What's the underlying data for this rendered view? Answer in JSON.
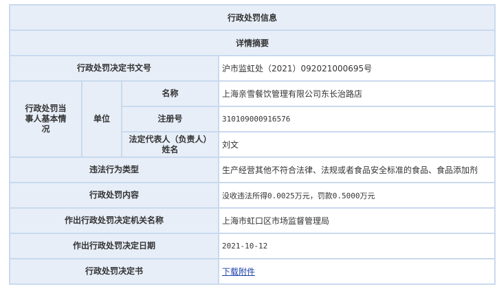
{
  "section_title": "行政处罚信息",
  "subsection_title": "详情摘要",
  "rows": {
    "decision_no": {
      "label": "行政处罚决定书文号",
      "value": "沪市监虹处（2021）092021000695号"
    },
    "party": {
      "label": "行政处罚当事人基本情况",
      "group_label": "单位",
      "name": {
        "label": "名称",
        "value": "上海亲雪餐饮管理有限公司东长治路店"
      },
      "reg_no": {
        "label": "注册号",
        "value": "310109000916576"
      },
      "legal_rep": {
        "label_line1": "法定代表人（负责人）",
        "label_line2": "姓名",
        "value": "刘文"
      }
    },
    "violation_type": {
      "label": "违法行为类型",
      "value": "生产经营其他不符合法律、法规或者食品安全标准的食品、食品添加剂"
    },
    "penalty_content": {
      "label": "行政处罚内容",
      "value": "没收违法所得0.0025万元，罚款0.5000万元"
    },
    "authority": {
      "label": "作出行政处罚决定机关名称",
      "value": "上海市虹口区市场监督管理局"
    },
    "decision_date": {
      "label": "作出行政处罚决定日期",
      "value": "2021-10-12"
    },
    "decision_doc": {
      "label": "行政处罚决定书",
      "link_text": "下载附件"
    }
  }
}
